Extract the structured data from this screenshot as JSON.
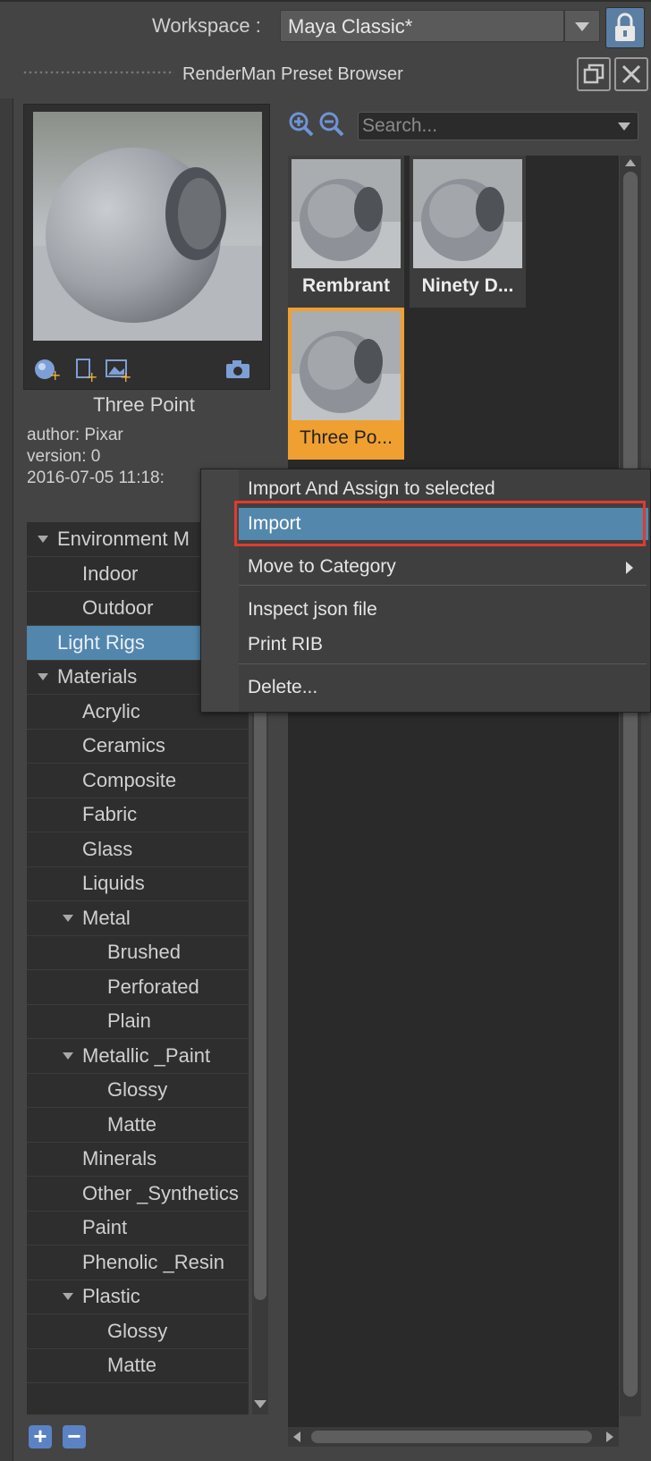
{
  "workspace": {
    "label": "Workspace :",
    "selected": "Maya Classic*"
  },
  "panel": {
    "title": "RenderMan Preset Browser"
  },
  "preview": {
    "name": "Three Point",
    "author": "author: Pixar",
    "version": "version: 0",
    "date": "2016-07-05 11:18:"
  },
  "search": {
    "placeholder": "Search..."
  },
  "thumbnails": [
    {
      "label": "Rembrant",
      "selected": false
    },
    {
      "label": "Ninety D...",
      "selected": false
    },
    {
      "label": "Three Po...",
      "selected": true
    }
  ],
  "tree": {
    "items": [
      {
        "label": "Environment M",
        "level": 0,
        "expanded": true
      },
      {
        "label": "Indoor",
        "level": 1
      },
      {
        "label": "Outdoor",
        "level": 1
      },
      {
        "label": "Light Rigs",
        "level": 0,
        "selected": true
      },
      {
        "label": "Materials",
        "level": 0,
        "expanded": true
      },
      {
        "label": "Acrylic",
        "level": 1
      },
      {
        "label": "Ceramics",
        "level": 1
      },
      {
        "label": "Composite",
        "level": 1
      },
      {
        "label": "Fabric",
        "level": 1
      },
      {
        "label": "Glass",
        "level": 1
      },
      {
        "label": "Liquids",
        "level": 1
      },
      {
        "label": "Metal",
        "level": 1,
        "expanded": true
      },
      {
        "label": "Brushed",
        "level": 2
      },
      {
        "label": "Perforated",
        "level": 2
      },
      {
        "label": "Plain",
        "level": 2
      },
      {
        "label": "Metallic _Paint",
        "level": 1,
        "expanded": true
      },
      {
        "label": "Glossy",
        "level": 2
      },
      {
        "label": "Matte",
        "level": 2
      },
      {
        "label": "Minerals",
        "level": 1
      },
      {
        "label": "Other _Synthetics",
        "level": 1
      },
      {
        "label": "Paint",
        "level": 1
      },
      {
        "label": "Phenolic _Resin",
        "level": 1
      },
      {
        "label": "Plastic",
        "level": 1,
        "expanded": true
      },
      {
        "label": "Glossy",
        "level": 2
      },
      {
        "label": "Matte",
        "level": 2
      }
    ],
    "add_label": "+",
    "remove_label": "−"
  },
  "context_menu": {
    "items": [
      {
        "label": "Import And Assign to selected"
      },
      {
        "label": "Import",
        "highlighted": true
      },
      {
        "label": "Move to Category",
        "submenu": true
      },
      {
        "label": "Inspect json file"
      },
      {
        "label": "Print RIB"
      },
      {
        "label": "Delete..."
      }
    ]
  },
  "colors": {
    "selection": "#5286ad",
    "thumb_selected": "#f0a030",
    "highlight_outline": "#e23a2e",
    "accent_icon": "#5b83c4"
  }
}
